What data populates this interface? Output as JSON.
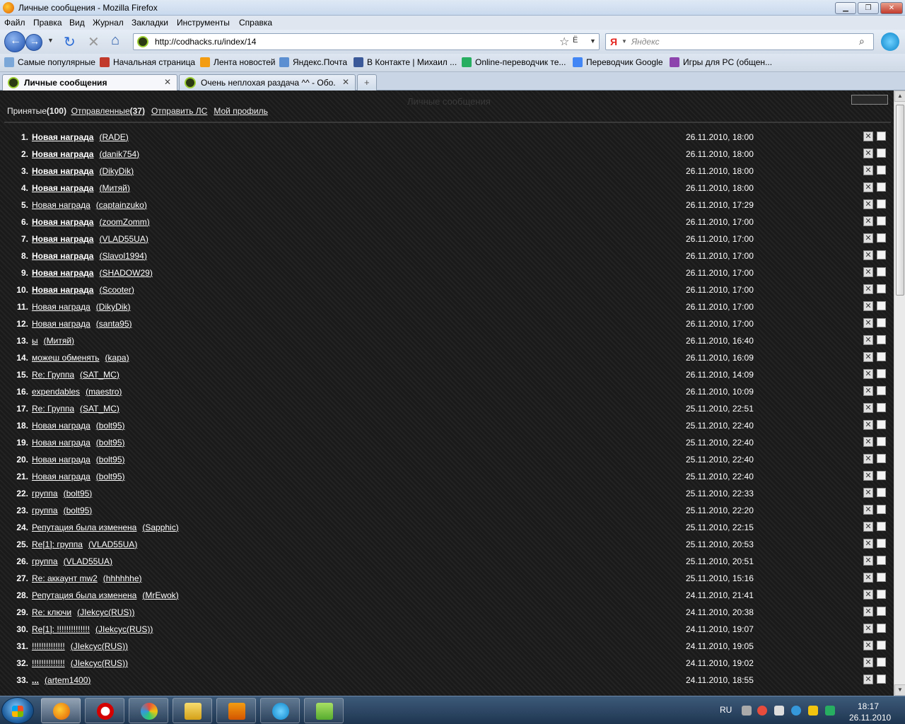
{
  "window": {
    "title": "Личные сообщения - Mozilla Firefox"
  },
  "menu": [
    "Файл",
    "Правка",
    "Вид",
    "Журнал",
    "Закладки",
    "Инструменты",
    "Справка"
  ],
  "nav": {
    "url": "http://codhacks.ru/index/14",
    "search_placeholder": "Яндекс",
    "search_engine_glyph": "Я"
  },
  "bookmarks": [
    "Самые популярные",
    "Начальная страница",
    "Лента новостей",
    "Яндекс.Почта",
    "В Контакте | Михаил ...",
    "Online-переводчик те...",
    "Переводчик Google",
    "Игры для PC (общен..."
  ],
  "tabs": [
    {
      "label": "Личные сообщения",
      "active": true
    },
    {
      "label": "Очень неплохая раздача ^^ - Обо...",
      "active": false
    }
  ],
  "page": {
    "header": "Личные сообщения",
    "pm_tabs": {
      "inbox_label": "Принятые",
      "inbox_count": "(100)",
      "sent_label": "Отправленные",
      "sent_count": "(37)",
      "compose_label": "Отправить ЛС",
      "profile_label": "Мой профиль"
    }
  },
  "messages": [
    {
      "num": "1.",
      "subject": "Новая награда",
      "author": "RADE",
      "date": "26.11.2010, 18:00",
      "unread": true
    },
    {
      "num": "2.",
      "subject": "Новая награда",
      "author": "danik754",
      "date": "26.11.2010, 18:00",
      "unread": true
    },
    {
      "num": "3.",
      "subject": "Новая награда",
      "author": "DikyDik",
      "date": "26.11.2010, 18:00",
      "unread": true
    },
    {
      "num": "4.",
      "subject": "Новая награда",
      "author": "Митяй",
      "date": "26.11.2010, 18:00",
      "unread": true
    },
    {
      "num": "5.",
      "subject": "Новая награда",
      "author": "captainzuko",
      "date": "26.11.2010, 17:29",
      "unread": false
    },
    {
      "num": "6.",
      "subject": "Новая награда",
      "author": "zoomZomm",
      "date": "26.11.2010, 17:00",
      "unread": true
    },
    {
      "num": "7.",
      "subject": "Новая награда",
      "author": "VLAD55UA",
      "date": "26.11.2010, 17:00",
      "unread": true
    },
    {
      "num": "8.",
      "subject": "Новая награда",
      "author": "Slavol1994",
      "date": "26.11.2010, 17:00",
      "unread": true
    },
    {
      "num": "9.",
      "subject": "Новая награда",
      "author": "SHADOW29",
      "date": "26.11.2010, 17:00",
      "unread": true
    },
    {
      "num": "10.",
      "subject": "Новая награда",
      "author": "Scooter",
      "date": "26.11.2010, 17:00",
      "unread": true
    },
    {
      "num": "11.",
      "subject": "Новая награда",
      "author": "DikyDik",
      "date": "26.11.2010, 17:00",
      "unread": false
    },
    {
      "num": "12.",
      "subject": "Новая награда",
      "author": "santa95",
      "date": "26.11.2010, 17:00",
      "unread": false
    },
    {
      "num": "13.",
      "subject": "ы",
      "author": "Митяй",
      "date": "26.11.2010, 16:40",
      "unread": false
    },
    {
      "num": "14.",
      "subject": "можеш обменять",
      "author": "kapa",
      "date": "26.11.2010, 16:09",
      "unread": false
    },
    {
      "num": "15.",
      "subject": "Re: Группа",
      "author": "SAT_MC",
      "date": "26.11.2010, 14:09",
      "unread": false
    },
    {
      "num": "16.",
      "subject": "expendables",
      "author": "maestro",
      "date": "26.11.2010, 10:09",
      "unread": false
    },
    {
      "num": "17.",
      "subject": "Re: Группа",
      "author": "SAT_MC",
      "date": "25.11.2010, 22:51",
      "unread": false
    },
    {
      "num": "18.",
      "subject": "Новая награда",
      "author": "bolt95",
      "date": "25.11.2010, 22:40",
      "unread": false
    },
    {
      "num": "19.",
      "subject": "Новая награда",
      "author": "bolt95",
      "date": "25.11.2010, 22:40",
      "unread": false
    },
    {
      "num": "20.",
      "subject": "Новая награда",
      "author": "bolt95",
      "date": "25.11.2010, 22:40",
      "unread": false
    },
    {
      "num": "21.",
      "subject": "Новая награда",
      "author": "bolt95",
      "date": "25.11.2010, 22:40",
      "unread": false
    },
    {
      "num": "22.",
      "subject": "группа",
      "author": "bolt95",
      "date": "25.11.2010, 22:33",
      "unread": false
    },
    {
      "num": "23.",
      "subject": "группа",
      "author": "bolt95",
      "date": "25.11.2010, 22:20",
      "unread": false
    },
    {
      "num": "24.",
      "subject": "Репутация была изменена",
      "author": "Sapphic",
      "date": "25.11.2010, 22:15",
      "unread": false
    },
    {
      "num": "25.",
      "subject": "Re[1]: группа",
      "author": "VLAD55UA",
      "date": "25.11.2010, 20:53",
      "unread": false
    },
    {
      "num": "26.",
      "subject": "группа",
      "author": "VLAD55UA",
      "date": "25.11.2010, 20:51",
      "unread": false
    },
    {
      "num": "27.",
      "subject": "Re: аккаунт mw2",
      "author": "hhhhhhe",
      "date": "25.11.2010, 15:16",
      "unread": false
    },
    {
      "num": "28.",
      "subject": "Репутация была изменена",
      "author": "MrEwok",
      "date": "24.11.2010, 21:41",
      "unread": false
    },
    {
      "num": "29.",
      "subject": "Re: ключи",
      "author": "JIekcyc(RUS)",
      "date": "24.11.2010, 20:38",
      "unread": false
    },
    {
      "num": "30.",
      "subject": "Re[1]: !!!!!!!!!!!!!!",
      "author": "JIekcyc(RUS)",
      "date": "24.11.2010, 19:07",
      "unread": false
    },
    {
      "num": "31.",
      "subject": "!!!!!!!!!!!!!!",
      "author": "JIekcyc(RUS)",
      "date": "24.11.2010, 19:05",
      "unread": false
    },
    {
      "num": "32.",
      "subject": "!!!!!!!!!!!!!!",
      "author": "JIekcyc(RUS)",
      "date": "24.11.2010, 19:02",
      "unread": false
    },
    {
      "num": "33.",
      "subject": "...",
      "author": "artem1400",
      "date": "24.11.2010, 18:55",
      "unread": true
    }
  ],
  "taskbar": {
    "apps": [
      "firefox-icon",
      "opera-icon",
      "paint-icon",
      "explorer-icon",
      "media-player-icon",
      "skype-icon",
      "utorrent-icon"
    ],
    "lang": "RU",
    "time": "18:17",
    "date": "26.11.2010"
  },
  "colors": {
    "page_bg": "#1c1c1c",
    "text": "#ffffff",
    "chrome": "#dfe6ef"
  }
}
